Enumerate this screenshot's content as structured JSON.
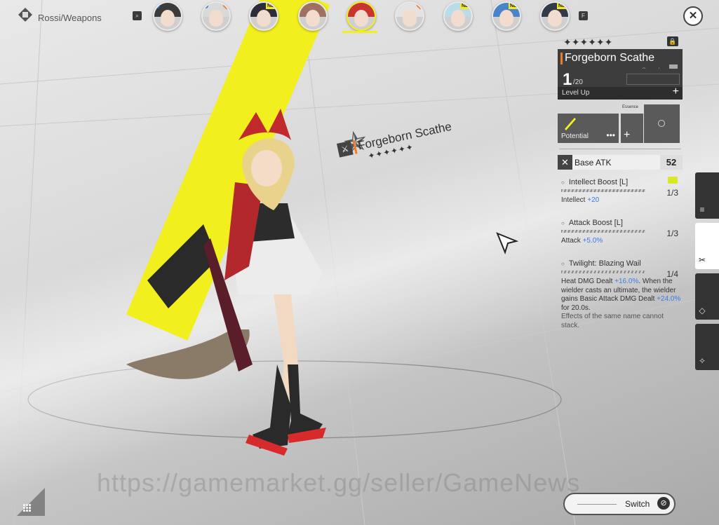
{
  "header": {
    "character_small": "",
    "title": "Rossi/Weapons",
    "search_icon": "search-icon",
    "filter_icon": "filter-icon"
  },
  "portraits": [
    {
      "name": "operator-1",
      "badge": "blue",
      "hair": "#3b3b3b"
    },
    {
      "name": "operator-2",
      "badge": "blue-orange",
      "hair": "#d9d9d9"
    },
    {
      "name": "operator-3",
      "badge": "new",
      "new_label": "NEW",
      "hair": "#2c2c3a"
    },
    {
      "name": "operator-4",
      "badge": "",
      "hair": "#a07060"
    },
    {
      "name": "operator-rossi",
      "badge": "",
      "hair": "#c8342f",
      "active": true
    },
    {
      "name": "operator-6",
      "badge": "orange",
      "hair": "#e3e3e3"
    },
    {
      "name": "operator-7",
      "badge": "new",
      "new_label": "NEW",
      "hair": "#b9dde8"
    },
    {
      "name": "operator-8",
      "badge": "new",
      "new_label": "NEW",
      "hair": "#4a84c8"
    },
    {
      "name": "operator-9",
      "badge": "new",
      "new_label": "NEW",
      "hair": "#333a48"
    }
  ],
  "scene": {
    "weapon_name": "Forgeborn Scathe",
    "weapon_stars": "✦✦✦✦✦✦",
    "watermark": "https://gamemarket.gg/seller/GameNews"
  },
  "weapon": {
    "rarity_stars": "✦✦✦✦✦✦",
    "name": "Forgeborn Scathe",
    "type": "Sword",
    "level": "1",
    "max_level": "/20",
    "level_up_label": "Level Up",
    "potential_label": "Potential",
    "essence_label": "Essence",
    "base_atk_label": "Base ATK",
    "base_atk_value": "52",
    "accent": "#ef7a2a"
  },
  "skills": [
    {
      "name": "Intellect Boost [L]",
      "level": "1/3",
      "stat": "Intellect",
      "value": "+20"
    },
    {
      "name": "Attack Boost [L]",
      "level": "1/3",
      "stat": "Attack",
      "value": "+5.0%"
    },
    {
      "name": "Twilight: Blazing Wail",
      "level": "1/4",
      "line1_pre": "Heat DMG Dealt",
      "line1_val": "+16.0%",
      "line1_post": ".",
      "line2_pre": "When the wielder casts an ultimate, the wielder gains Basic Attack DMG Dealt",
      "line2_val": "+24.0%",
      "line2_post": "for 20.0s.",
      "line3": "Effects of the same name cannot stack."
    }
  ],
  "footer": {
    "switch_label": "Switch"
  },
  "colors": {
    "highlight": "#f1ef1d",
    "stat_blue": "#3d7be6"
  }
}
